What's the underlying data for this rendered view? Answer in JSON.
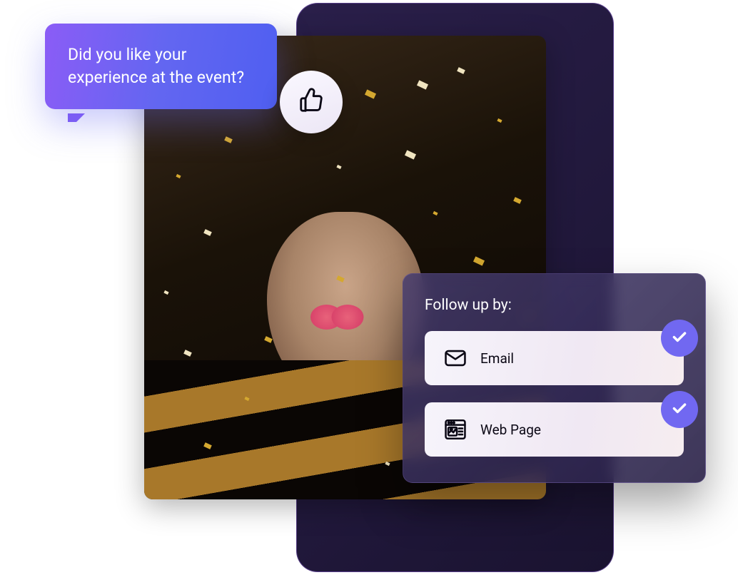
{
  "speech_bubble": {
    "text": "Did you like your experience at the event?"
  },
  "reaction": {
    "icon": "thumbs-up"
  },
  "followup": {
    "title": "Follow up by:",
    "options": [
      {
        "label": "Email",
        "icon": "email",
        "selected": true
      },
      {
        "label": "Web Page",
        "icon": "web-page",
        "selected": true
      }
    ]
  },
  "colors": {
    "accent": "#7168f1",
    "gradient_start": "#8b5cf6",
    "gradient_end": "#4f5ff1"
  }
}
